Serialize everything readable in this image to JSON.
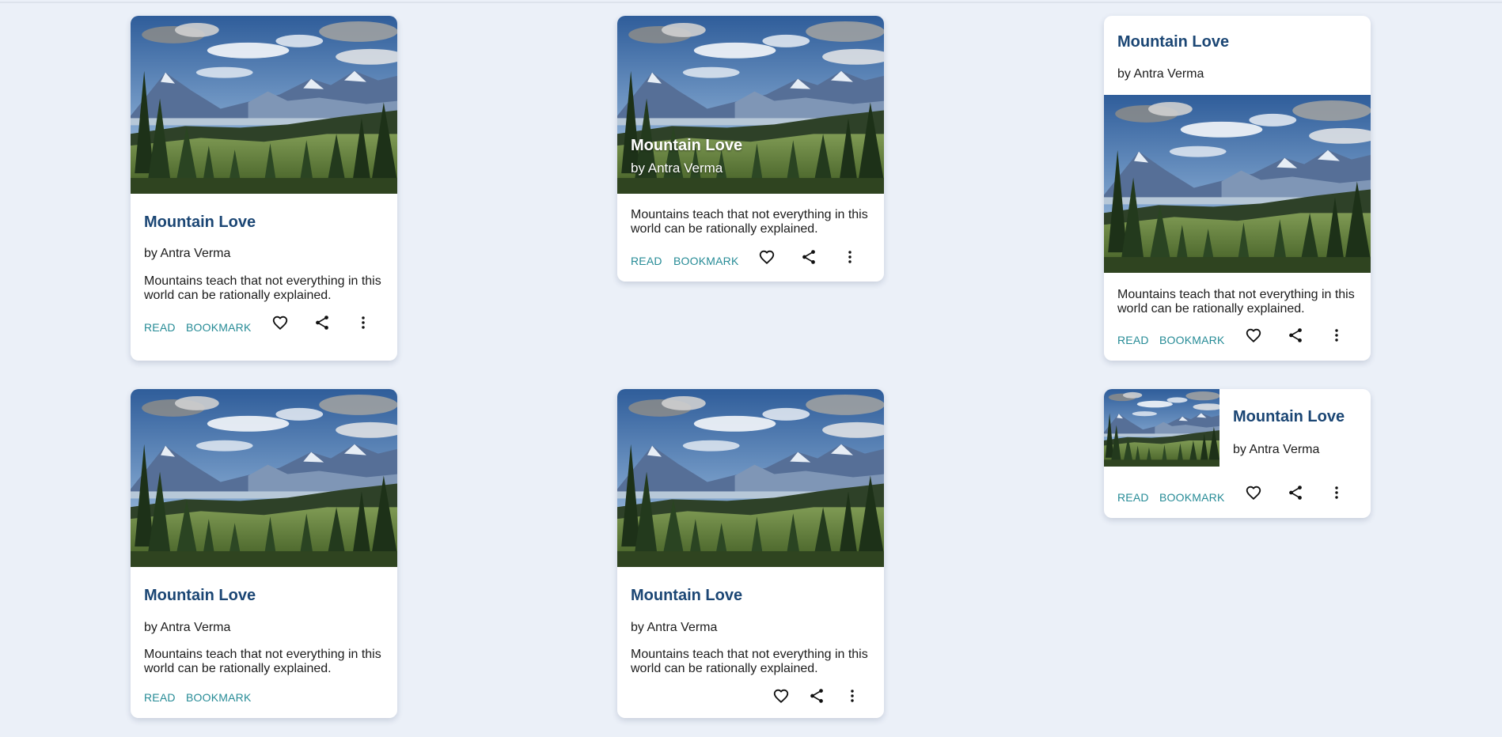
{
  "cards": [
    {
      "title": "Mountain Love",
      "author": "by Antra Verma",
      "description": "Mountains teach that not everything in this world can be rationally explained.",
      "read_label": "READ",
      "bookmark_label": "BOOKMARK"
    },
    {
      "title": "Mountain Love",
      "author": "by Antra Verma",
      "description": "Mountains teach that not everything in this world can be rationally explained.",
      "read_label": "READ",
      "bookmark_label": "BOOKMARK"
    },
    {
      "title": "Mountain Love",
      "author": "by Antra Verma",
      "description": "Mountains teach that not everything in this world can be rationally explained.",
      "read_label": "READ",
      "bookmark_label": "BOOKMARK"
    },
    {
      "title": "Mountain Love",
      "author": "by Antra Verma",
      "description": "Mountains teach that not everything in this world can be rationally explained.",
      "read_label": "READ",
      "bookmark_label": "BOOKMARK"
    },
    {
      "title": "Mountain Love",
      "author": "by Antra Verma",
      "description": "Mountains teach that not everything in this world can be rationally explained."
    },
    {
      "title": "Mountain Love",
      "author": "by Antra Verma",
      "read_label": "READ",
      "bookmark_label": "BOOKMARK"
    }
  ],
  "icons": {
    "like": "heart-icon",
    "share": "share-icon",
    "more": "more-vertical-icon"
  },
  "colors": {
    "background": "#ebf0f8",
    "title": "#1b4674",
    "action": "#268b96",
    "card": "#ffffff"
  }
}
